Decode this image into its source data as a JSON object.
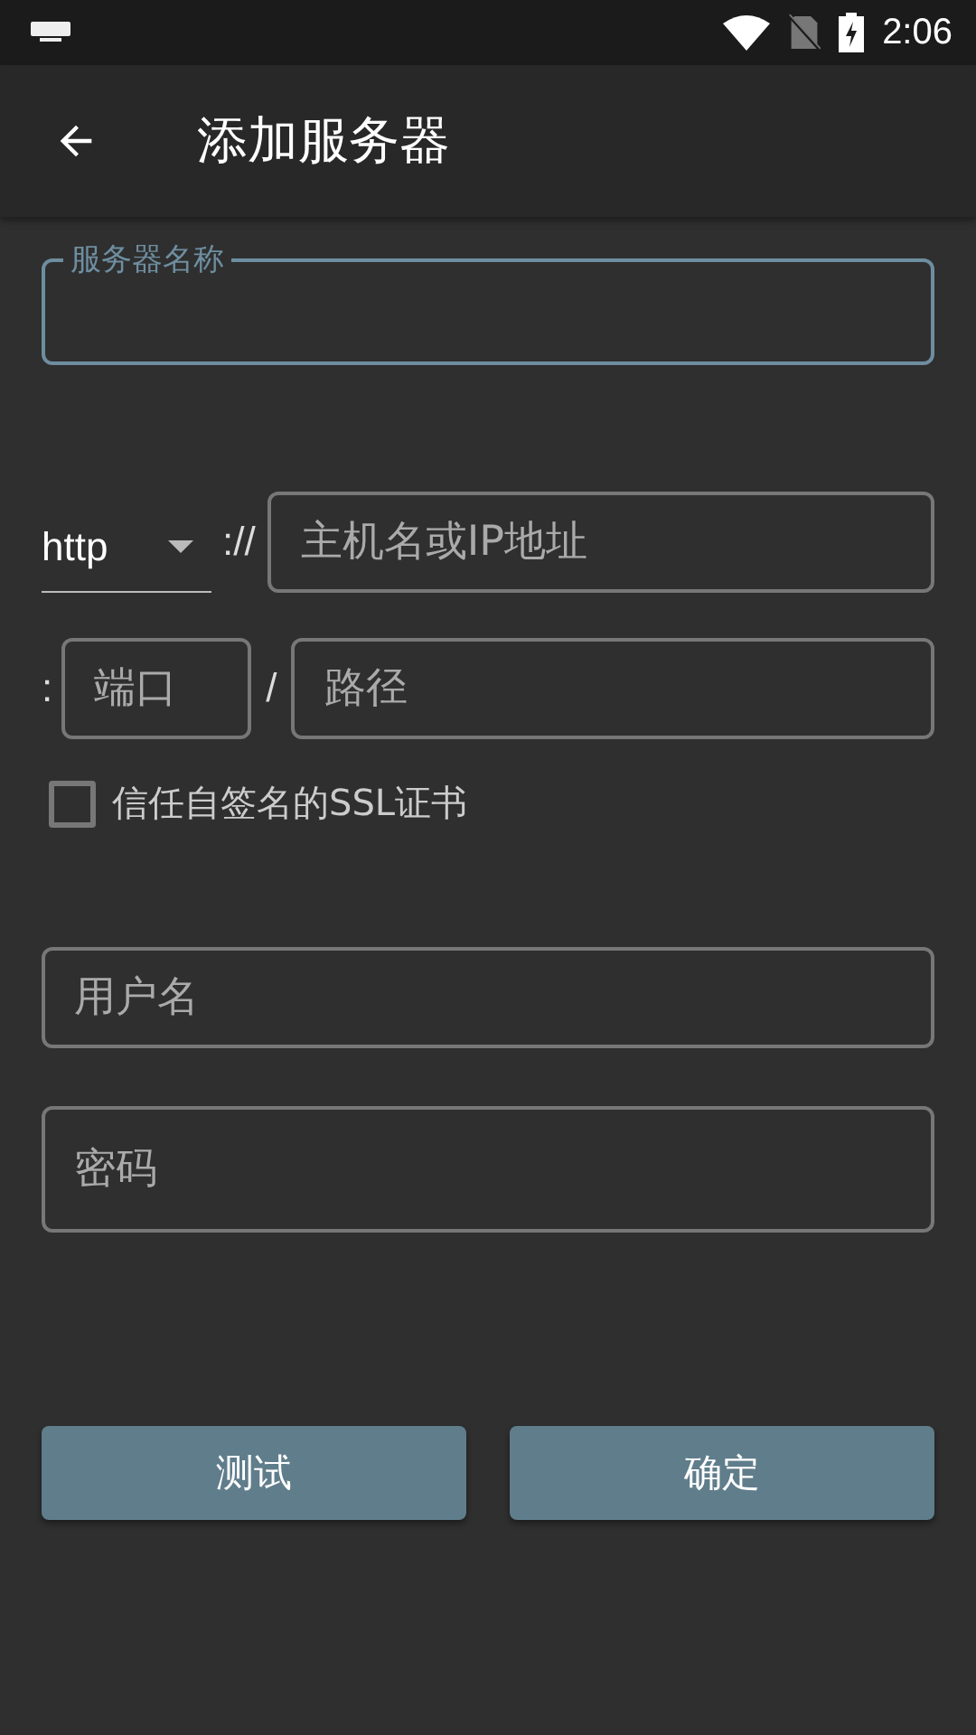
{
  "status_bar": {
    "time": "2:06"
  },
  "app_bar": {
    "title": "添加服务器"
  },
  "server_name": {
    "label": "服务器名称",
    "focused": true
  },
  "scheme": {
    "value": "http"
  },
  "scheme_separator": "://",
  "host": {
    "placeholder": "主机名或IP地址"
  },
  "port_prefix": ":",
  "port": {
    "placeholder": "端口"
  },
  "path_separator": "/",
  "path": {
    "placeholder": "路径"
  },
  "trust_ssl": {
    "label": "信任自签名的SSL证书",
    "checked": false
  },
  "username": {
    "placeholder": "用户名"
  },
  "password": {
    "placeholder": "密码"
  },
  "buttons": [
    {
      "label": "测试"
    },
    {
      "label": "确定"
    }
  ]
}
